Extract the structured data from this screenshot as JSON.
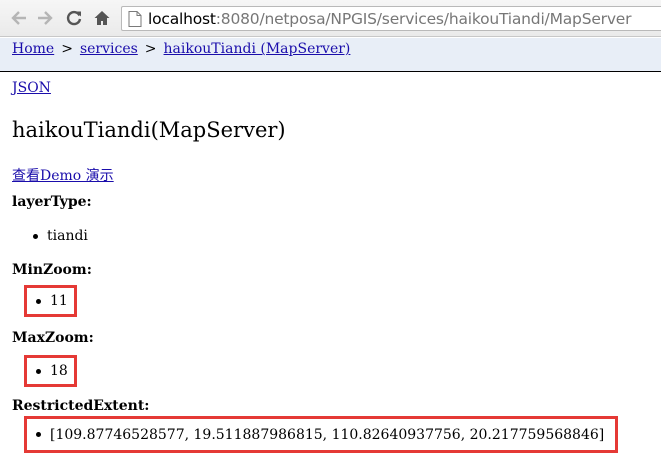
{
  "browser": {
    "url_host": "localhost",
    "url_rest": ":8080/netposa/NPGIS/services/haikouTiandi/MapServer"
  },
  "breadcrumb": {
    "home": "Home",
    "sep": ">",
    "services": "services",
    "current": "haikouTiandi (MapServer)"
  },
  "page": {
    "json_link": "JSON",
    "title": "haikouTiandi(MapServer)",
    "demo_link": "查看Demo 演示 "
  },
  "properties": {
    "layer_type_label": "layerType:",
    "layer_type_value": "tiandi",
    "min_zoom_label": "MinZoom:",
    "min_zoom_value": "11",
    "max_zoom_label": "MaxZoom:",
    "max_zoom_value": "18",
    "restricted_extent_label": "RestrictedExtent:",
    "restricted_extent_value": "[109.87746528577, 19.511887986815, 110.82640937756, 20.217759568846]"
  },
  "colors": {
    "highlight_box": "#e53935",
    "link": "#1a0dab",
    "breadcrumb_bg": "#e8eef7"
  }
}
